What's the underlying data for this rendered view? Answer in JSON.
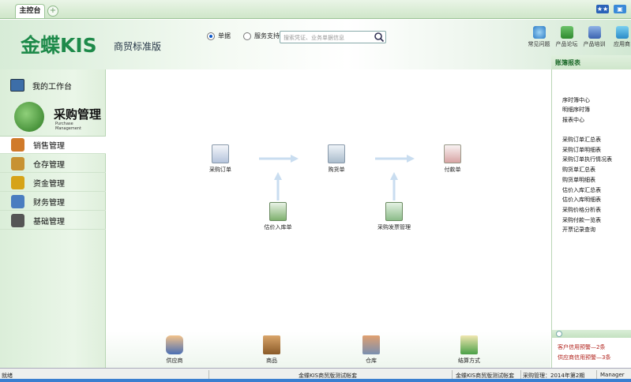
{
  "tabs": {
    "main": "主控台",
    "add": "+"
  },
  "header": {
    "brand": "金蝶KIS",
    "subtitle": "商贸标准版",
    "radio_documents": "单据",
    "radio_service": "服务支持",
    "search_placeholder": "搜索凭证、业务单据信息",
    "tools": [
      "常见问题",
      "产品论坛",
      "产品培训",
      "应用商"
    ]
  },
  "sidebar": {
    "workbench": "我的工作台",
    "module_title": "采购管理",
    "module_en_1": "Purchase",
    "module_en_2": "Management",
    "items": [
      {
        "label": "销售管理",
        "color": "#d07a2a"
      },
      {
        "label": "仓存管理",
        "color": "#c79233"
      },
      {
        "label": "资金管理",
        "color": "#d6a318"
      },
      {
        "label": "财务管理",
        "color": "#4a7dc0"
      },
      {
        "label": "基础管理",
        "color": "#555555"
      }
    ]
  },
  "flow": {
    "purchase_order": "采购订单",
    "receipt": "购货单",
    "payment": "付款单",
    "estimated_receipt": "估价入库单",
    "invoice_mgmt": "采购发票管理"
  },
  "shortcuts": [
    "供应商",
    "商品",
    "仓库",
    "结算方式"
  ],
  "right_panel": {
    "title": "账簿报表",
    "group1": [
      "序时簿中心",
      "明细序时簿",
      "报表中心"
    ],
    "group2": [
      "采购订单汇总表",
      "采购订单明细表",
      "采购订单执行情况表",
      "购货单汇总表",
      "购货单明细表",
      "估价入库汇总表",
      "估价入库明细表",
      "采购价格分析表",
      "采购付款一览表",
      "开票记录查询"
    ],
    "alerts": [
      "客户信用预警—2条",
      "供应商信用预警—3条"
    ]
  },
  "status": {
    "ready": "就绪",
    "account1": "金蝶KIS商贸版测试帐套",
    "account2": "金蝶KIS商贸版测试帐套",
    "period": "采购管理：2014年第2期",
    "user": "Manager"
  },
  "colors": {
    "brand_green": "#1e8a4a",
    "arrow": "#c9ddf0",
    "alert_red": "#b0201a"
  }
}
